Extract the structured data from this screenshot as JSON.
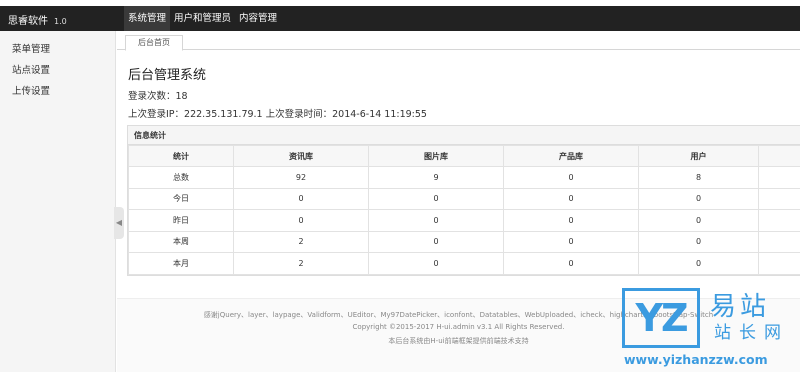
{
  "app": {
    "brand": "思睿软件",
    "version": "1.0"
  },
  "nav": [
    {
      "label": "系统管理"
    },
    {
      "label": "用户和管理员"
    },
    {
      "label": "内容管理"
    }
  ],
  "sidebar": {
    "items": [
      {
        "label": "菜单管理"
      },
      {
        "label": "站点设置"
      },
      {
        "label": "上传设置"
      }
    ]
  },
  "tabs": [
    {
      "label": "后台首页"
    }
  ],
  "main": {
    "title": "后台管理系统",
    "login_count": "登录次数：18",
    "last_login": "上次登录IP：222.35.131.79.1 上次登录时间：2014-6-14 11:19:55"
  },
  "stats": {
    "heading": "信息统计",
    "columns": [
      "统计",
      "资讯库",
      "图片库",
      "产品库",
      "用户"
    ],
    "rows": [
      [
        "总数",
        "92",
        "9",
        "0",
        "8"
      ],
      [
        "今日",
        "0",
        "0",
        "0",
        "0"
      ],
      [
        "昨日",
        "0",
        "0",
        "0",
        "0"
      ],
      [
        "本周",
        "2",
        "0",
        "0",
        "0"
      ],
      [
        "本月",
        "2",
        "0",
        "0",
        "0"
      ]
    ]
  },
  "footer": {
    "line1": "感谢jQuery、layer、laypage、Validform、UEditor、My97DatePicker、iconfont、Datatables、WebUploaded、icheck、highcharts、bootstrap-Switch",
    "line2": "Copyright ©2015-2017 H-ui.admin v3.1 All Rights Reserved.",
    "line3": "本后台系统由H-ui前端框架提供前端技术支持"
  },
  "watermark": {
    "logo": "YZ",
    "cn1": "易站",
    "cn2": "站长网",
    "url": "www.yizhanzzw.com"
  }
}
